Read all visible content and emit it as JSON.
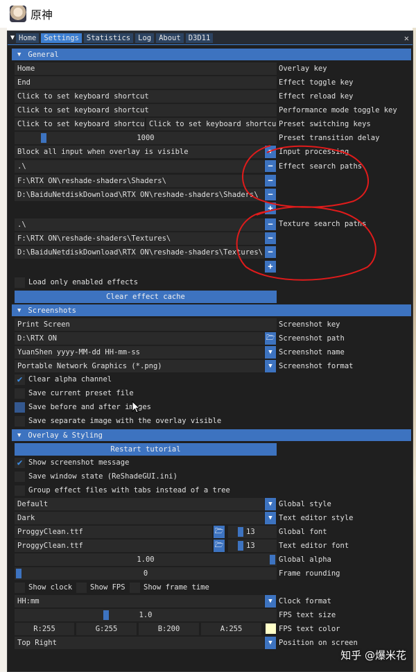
{
  "window": {
    "title": "原神"
  },
  "tabs": [
    "Home",
    "Settings",
    "Statistics",
    "Log",
    "About",
    "D3D11"
  ],
  "sections": {
    "general": "General",
    "screenshots": "Screenshots",
    "overlay": "Overlay & Styling"
  },
  "general": {
    "overlay_key": {
      "value": "Home",
      "label": "Overlay key"
    },
    "effect_toggle_key": {
      "value": "End",
      "label": "Effect toggle key"
    },
    "effect_reload_key": {
      "value": "Click to set keyboard shortcut",
      "label": "Effect reload key"
    },
    "performance_toggle_key": {
      "value": "Click to set keyboard shortcut",
      "label": "Performance mode toggle key"
    },
    "preset_switching_keys": {
      "value1": "Click to set keyboard shortcut",
      "value2": "Click to set keyboard shortcut",
      "label": "Preset switching keys"
    },
    "preset_transition_delay": {
      "value": "1000",
      "label": "Preset transition delay"
    },
    "input_processing": {
      "value": "Block all input when overlay is visible",
      "label": "Input processing"
    },
    "effect_search_paths": {
      "label": "Effect search paths",
      "paths": [
        ".\\",
        "F:\\RTX ON\\reshade-shaders\\Shaders\\",
        "D:\\BaiduNetdiskDownload\\RTX ON\\reshade-shaders\\Shaders\\"
      ]
    },
    "texture_search_paths": {
      "label": "Texture search paths",
      "paths": [
        ".\\",
        "F:\\RTX ON\\reshade-shaders\\Textures\\",
        "D:\\BaiduNetdiskDownload\\RTX ON\\reshade-shaders\\Textures\\"
      ]
    },
    "load_only_enabled": "Load only enabled effects",
    "clear_cache": "Clear effect cache"
  },
  "screenshots": {
    "key": {
      "value": "Print Screen",
      "label": "Screenshot key"
    },
    "path": {
      "value": "D:\\RTX ON",
      "label": "Screenshot path"
    },
    "name": {
      "value": "YuanShen yyyy-MM-dd HH-mm-ss",
      "label": "Screenshot name"
    },
    "format": {
      "value": "Portable Network Graphics (*.png)",
      "label": "Screenshot format"
    },
    "clear_alpha": "Clear alpha channel",
    "save_preset": "Save current preset file",
    "save_before_after": "Save before and after images",
    "save_separate": "Save separate image with the overlay visible"
  },
  "overlay": {
    "restart_tutorial": "Restart tutorial",
    "show_screenshot_msg": "Show screenshot message",
    "save_window_state": "Save window state (ReShadeGUI.ini)",
    "group_tabs": "Group effect files with tabs instead of a tree",
    "global_style": {
      "value": "Default",
      "label": "Global style"
    },
    "text_editor_style": {
      "value": "Dark",
      "label": "Text editor style"
    },
    "global_font": {
      "value": "ProggyClean.ttf",
      "size": "13",
      "label": "Global font"
    },
    "text_editor_font": {
      "value": "ProggyClean.ttf",
      "size": "13",
      "label": "Text editor font"
    },
    "global_alpha": {
      "value": "1.00",
      "label": "Global alpha",
      "fraction": 1.0
    },
    "frame_rounding": {
      "value": "0",
      "label": "Frame rounding",
      "fraction": 0.0
    },
    "show_clock": "Show clock",
    "show_fps": "Show FPS",
    "show_frame_time": "Show frame time",
    "clock_format": {
      "value": "HH:mm",
      "label": "Clock format"
    },
    "fps_text_size": {
      "value": "1.0",
      "label": "FPS text size"
    },
    "fps_color": {
      "r": "R:255",
      "g": "G:255",
      "b": "B:200",
      "a": "A:255",
      "label": "FPS text color",
      "swatch": "#ffffc8"
    },
    "position": {
      "value": "Top Right",
      "label": "Position on screen"
    }
  },
  "watermark": "知乎 @爆米花",
  "colors": {
    "accent": "#3d73c0",
    "background": "#1f1f1f",
    "annotation": "#e01b1b"
  }
}
